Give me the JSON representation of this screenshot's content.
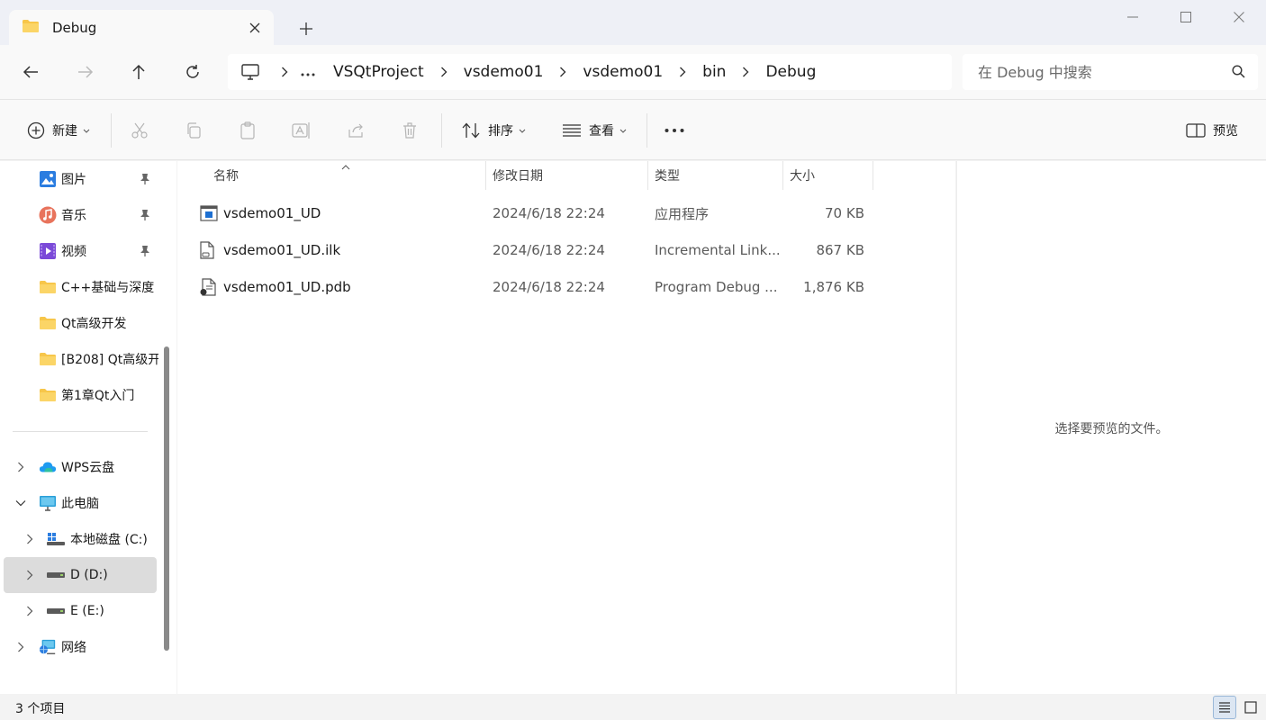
{
  "window": {
    "tab_title": "Debug",
    "colors": {
      "accent": "#0067c0",
      "folder": "#f7c64a",
      "selected": "#dcdcdc"
    }
  },
  "address": {
    "crumbs": [
      "VSQtProject",
      "vsdemo01",
      "vsdemo01",
      "bin",
      "Debug"
    ]
  },
  "search": {
    "placeholder": "在 Debug 中搜索"
  },
  "toolbar": {
    "new_label": "新建",
    "sort_label": "排序",
    "view_label": "查看",
    "preview_label": "预览"
  },
  "sidebar": {
    "items": [
      {
        "label": "图片",
        "icon": "pictures-icon",
        "pinned": true
      },
      {
        "label": "音乐",
        "icon": "music-icon",
        "pinned": true
      },
      {
        "label": "视频",
        "icon": "videos-icon",
        "pinned": true
      },
      {
        "label": "C++基础与深度",
        "icon": "folder-icon"
      },
      {
        "label": "Qt高级开发",
        "icon": "folder-icon"
      },
      {
        "label": "[B208] Qt高级开",
        "icon": "folder-icon"
      },
      {
        "label": "第1章Qt入门",
        "icon": "folder-icon"
      },
      {
        "label": "WPS云盘",
        "icon": "cloud-icon"
      },
      {
        "label": "此电脑",
        "icon": "this-pc-icon"
      },
      {
        "label": "本地磁盘 (C:)",
        "icon": "drive-c-icon"
      },
      {
        "label": "D (D:)",
        "icon": "drive-icon"
      },
      {
        "label": "E (E:)",
        "icon": "drive-icon"
      },
      {
        "label": "网络",
        "icon": "network-icon"
      }
    ]
  },
  "files": {
    "columns": [
      "名称",
      "修改日期",
      "类型",
      "大小"
    ],
    "rows": [
      {
        "name": "vsdemo01_UD",
        "date": "2024/6/18 22:24",
        "type": "应用程序",
        "size": "70 KB",
        "icon": "exe-icon"
      },
      {
        "name": "vsdemo01_UD.ilk",
        "date": "2024/6/18 22:24",
        "type": "Incremental Link...",
        "size": "867 KB",
        "icon": "ilk-file-icon"
      },
      {
        "name": "vsdemo01_UD.pdb",
        "date": "2024/6/18 22:24",
        "type": "Program Debug ...",
        "size": "1,876 KB",
        "icon": "pdb-file-icon"
      }
    ]
  },
  "preview": {
    "message": "选择要预览的文件。"
  },
  "status": {
    "item_count": "3 个项目"
  }
}
